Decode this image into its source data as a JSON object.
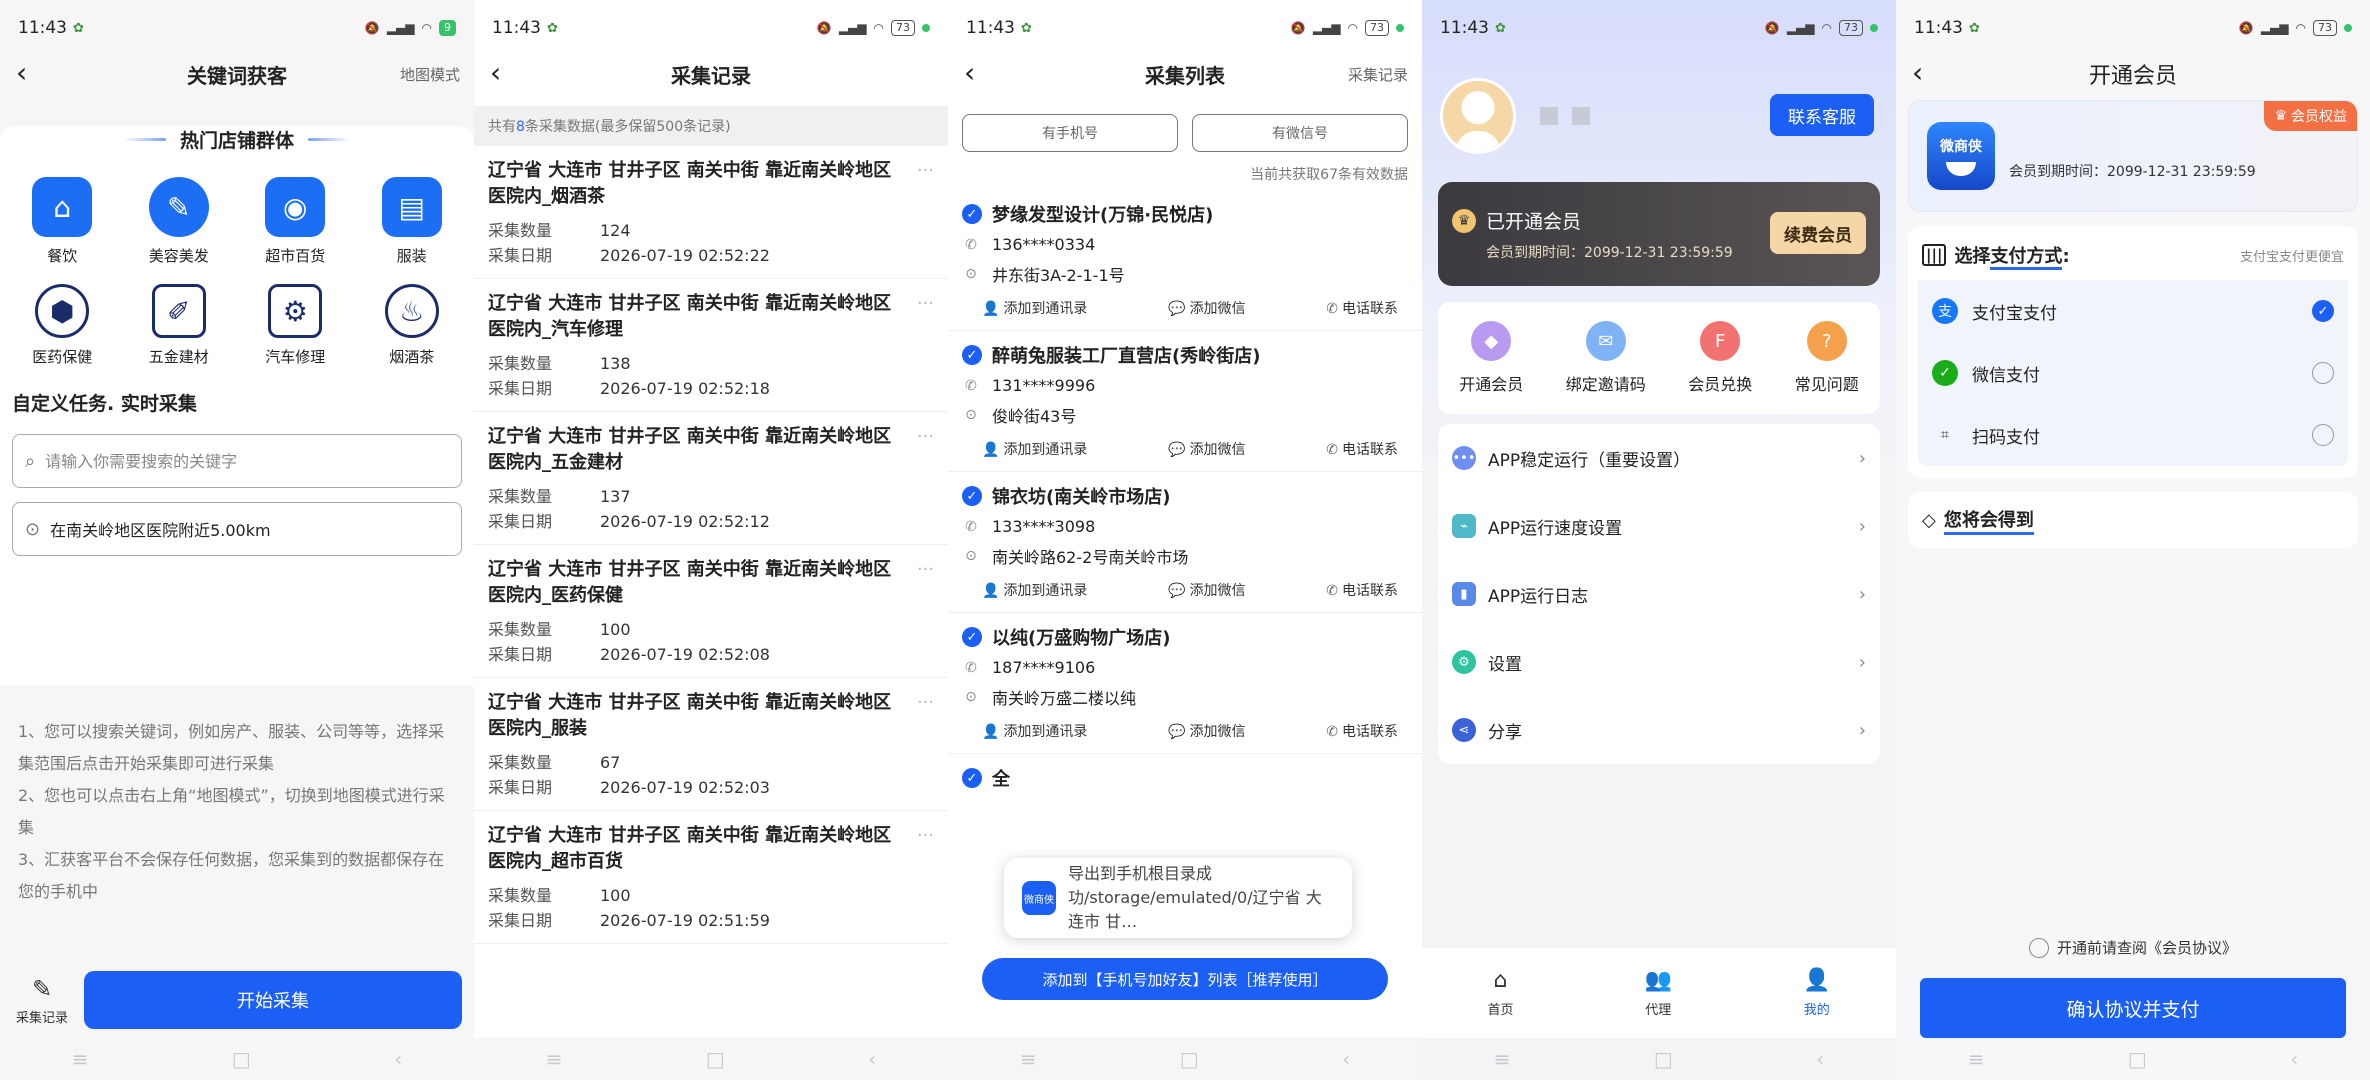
{
  "status": {
    "time": "11:43",
    "battery_1": "9",
    "battery": "73"
  },
  "screen1": {
    "title": "关键词获客",
    "map_mode": "地图模式",
    "hot_title": "热门店铺群体",
    "categories": [
      "餐饮",
      "美容美发",
      "超市百货",
      "服装",
      "医药保健",
      "五金建材",
      "汽车修理",
      "烟酒茶"
    ],
    "section_title": "自定义任务. 实时采集",
    "search_placeholder": "请输入你需要搜索的关键字",
    "location_text": "在南关岭地区医院附近5.00km",
    "tips": [
      "1、您可以搜索关键词，例如房产、服装、公司等等，选择采集范围后点击开始采集即可进行采集",
      "2、您也可以点击右上角“地图模式”，切换到地图模式进行采集",
      "3、汇获客平台不会保存任何数据，您采集到的数据都保存在您的手机中"
    ],
    "records_label": "采集记录",
    "start_label": "开始采集"
  },
  "screen2": {
    "title": "采集记录",
    "summary_pre": "共有",
    "summary_num": "8",
    "summary_post": "条采集数据(最多保留500条记录)",
    "count_label": "采集数量",
    "date_label": "采集日期",
    "records": [
      {
        "addr": "辽宁省 大连市 甘井子区 南关中街 靠近南关岭地区医院内_烟酒茶",
        "count": "124",
        "date": "2026-07-19 02:52:22"
      },
      {
        "addr": "辽宁省 大连市 甘井子区 南关中街 靠近南关岭地区医院内_汽车修理",
        "count": "138",
        "date": "2026-07-19 02:52:18"
      },
      {
        "addr": "辽宁省 大连市 甘井子区 南关中街 靠近南关岭地区医院内_五金建材",
        "count": "137",
        "date": "2026-07-19 02:52:12"
      },
      {
        "addr": "辽宁省 大连市 甘井子区 南关中街 靠近南关岭地区医院内_医药保健",
        "count": "100",
        "date": "2026-07-19 02:52:08"
      },
      {
        "addr": "辽宁省 大连市 甘井子区 南关中街 靠近南关岭地区医院内_服装",
        "count": "67",
        "date": "2026-07-19 02:52:03"
      },
      {
        "addr": "辽宁省 大连市 甘井子区 南关中街 靠近南关岭地区医院内_超市百货",
        "count": "100",
        "date": "2026-07-19 02:51:59"
      }
    ]
  },
  "screen3": {
    "title": "采集列表",
    "right_link": "采集记录",
    "filter_phone": "有手机号",
    "filter_wechat": "有微信号",
    "count_line": "当前共获取67条有效数据",
    "act_contacts": "添加到通讯录",
    "act_wechat": "添加微信",
    "act_call": "电话联系",
    "shops": [
      {
        "name": "梦缘发型设计(万锦·民悦店)",
        "phone": "136****0334",
        "addr": "井东街3A-2-1-1号"
      },
      {
        "name": "醉萌兔服装工厂直营店(秀岭街店)",
        "phone": "131****9996",
        "addr": "俊岭街43号"
      },
      {
        "name": "锦衣坊(南关岭市场店)",
        "phone": "133****3098",
        "addr": "南关岭路62-2号南关岭市场"
      },
      {
        "name": "以纯(万盛购物广场店)",
        "phone": "187****9106",
        "addr": "南关岭万盛二楼以纯"
      }
    ],
    "select_all": "全",
    "toast_logo": "微商侠",
    "toast": "导出到手机根目录成功/storage/emulated/0/辽宁省 大连市 甘…",
    "add_btn": "添加到【手机号加好友】列表［推荐使用］"
  },
  "screen4": {
    "service": "联系客服",
    "vip_title": "已开通会员",
    "vip_expire": "会员到期时间：2099-12-31 23:59:59",
    "renew": "续费会员",
    "quick": [
      "开通会员",
      "绑定邀请码",
      "会员兑换",
      "常见问题"
    ],
    "menu": [
      "APP稳定运行（重要设置）",
      "APP运行速度设置",
      "APP运行日志",
      "设置",
      "分享"
    ],
    "tabs": [
      "首页",
      "代理",
      "我的"
    ]
  },
  "screen5": {
    "title": "开通会员",
    "app_name": "微商侠",
    "rights": "会员权益",
    "expire": "会员到期时间：2099-12-31 23:59:59",
    "pay_title_pre": "选择",
    "pay_title_u": "支付方式",
    "pay_title_post": ":",
    "pay_hint": "支付宝支付更便宜",
    "options": [
      "支付宝支付",
      "微信支付",
      "扫码支付"
    ],
    "gain": "您将会得到",
    "agree": "开通前请查阅《会员协议》",
    "confirm": "确认协议并支付"
  },
  "colors": {
    "primary": "#1c5ff5",
    "vip_gold": "#f5d6a6",
    "rights_tag": "#f27044"
  }
}
